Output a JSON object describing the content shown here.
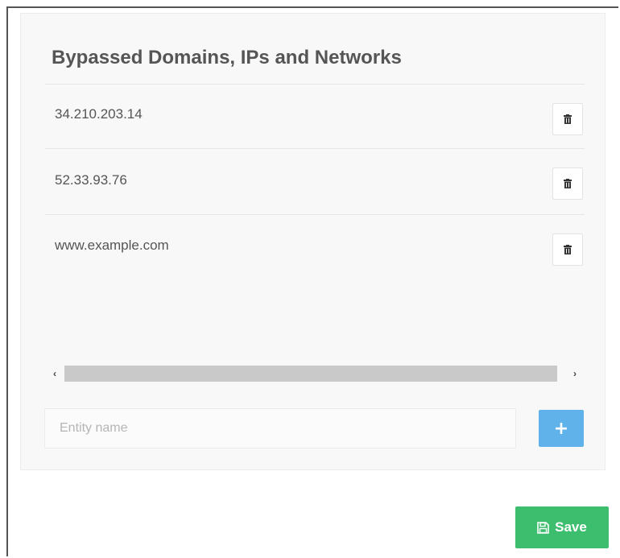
{
  "panel": {
    "title": "Bypassed Domains, IPs and Networks",
    "entries": [
      {
        "value": "34.210.203.14",
        "delete_icon": "trash-icon"
      },
      {
        "value": "52.33.93.76",
        "delete_icon": "trash-icon"
      },
      {
        "value": "www.example.com",
        "delete_icon": "trash-icon"
      }
    ],
    "scrollbar": {
      "left_arrow": "‹",
      "right_arrow": "›"
    },
    "input": {
      "value": "",
      "placeholder": "Entity name"
    },
    "add_button": {
      "label": "+",
      "color": "#5fb3ea"
    }
  },
  "footer": {
    "save_button": {
      "label": "Save",
      "icon": "floppy-disk-icon",
      "color": "#3dbd6e"
    }
  }
}
